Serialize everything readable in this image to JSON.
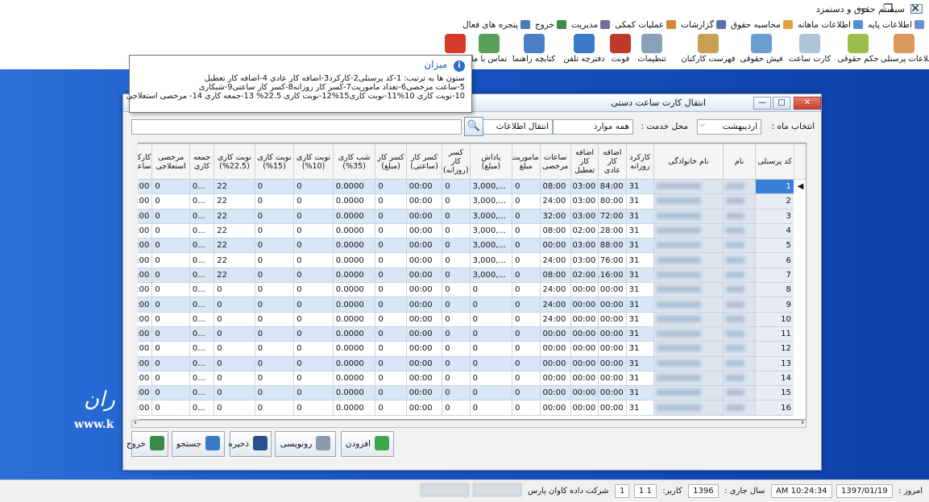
{
  "window": {
    "title": "سیستم حقوق و دستمزد",
    "minimize": "—",
    "restore": "❐",
    "close": "✕"
  },
  "menu": [
    {
      "label": "اطلاعات پایه",
      "color": "#6a8fd0"
    },
    {
      "label": "اطلاعات ماهانه",
      "color": "#4f8fd6"
    },
    {
      "label": "محاسبه حقوق",
      "color": "#e2a23a"
    },
    {
      "label": "گزارشات",
      "color": "#5a6fa8"
    },
    {
      "label": "عملیات کمکی",
      "color": "#d0883a"
    },
    {
      "label": "مدیریت",
      "color": "#7a6aa0"
    },
    {
      "label": "خروج",
      "color": "#3a8a4a"
    },
    {
      "label": "پنجره های فعال",
      "color": "#4a7ab0"
    }
  ],
  "toolbar": [
    {
      "label": "اطلاعات پرسنلی",
      "color": "#d89a5a"
    },
    {
      "label": "حکم حقوقی",
      "color": "#9bbf4a"
    },
    {
      "label": "کارت ساعت",
      "color": "#b0c4d8"
    },
    {
      "label": "فیش حقوقی",
      "color": "#6a9fd0"
    },
    {
      "label": "فهرست کارکنان",
      "color": "#c8a050"
    },
    {
      "label": "تنظیمات",
      "color": "#8aa0b8"
    },
    {
      "label": "فونت",
      "color": "#c0392b"
    },
    {
      "label": "دفترچه تلفن",
      "color": "#3a7ac8"
    },
    {
      "label": "کتابچه راهنما",
      "color": "#4a7fc4"
    },
    {
      "label": "تماس با ما",
      "color": "#5aa05a"
    },
    {
      "label": "",
      "color": "#d83a2a"
    }
  ],
  "tooltip": {
    "title": "میزان",
    "info_glyph": "i",
    "lines": [
      "ستون ها به ترتیب: 1-کد پرسنلی2-کارکرد3-اضافه کار عادی 4-اضافه کار تعطیل",
      "5-ساعت مرخصی6-تعداد ماموریت7-کسر کار روزانه8-کسر کار ساعتی9-شبکاری",
      "10-نوبت کاری 10%11-نوبت کاری15%12-نوبت کاری 22.5% 13-جمعه کاری 14- مرخصی استعلاجی"
    ]
  },
  "dialog": {
    "title": "انتقال کارت ساعت دستی",
    "month_label": "انتخاب ماه :",
    "month_value": "اردیبهشت",
    "service_label": "محل خدمت :",
    "service_value": "همه موارد",
    "info_transfer": "انتقال اطلاعات",
    "search_value": ""
  },
  "grid": {
    "headers": [
      "کد پرسنلی",
      "نام",
      "نام خانوادگی",
      "کارکرد روزانه",
      "اضافه کار عادی",
      "اضافه کار تعطیل",
      "ساعات مرخصی",
      "ماموریت مبلغ",
      "پاداش (مبلغ)",
      "کسر کار (روزانه)",
      "کسر کار (ساعتی)",
      "کسر کار (مبلغ)",
      "شب کاری (35%)",
      "نوبت کاری (10%)",
      "نوبت کاری (15%)",
      "نوبت کاری (22.5%)",
      "جمعه کاری",
      "مرخصی استعلاجی",
      "کارکرد ساعت"
    ],
    "rows": [
      [
        "1",
        "31",
        "84:00",
        "03:00",
        "08:00",
        "0",
        "...,3,000",
        "0",
        "00:00",
        "0",
        "0.0000",
        "0",
        "0",
        "22",
        "...0",
        "0",
        "00:00"
      ],
      [
        "2",
        "31",
        "80:00",
        "03:00",
        "24:00",
        "0",
        "...,3,000",
        "0",
        "00:00",
        "0",
        "0.0000",
        "0",
        "0",
        "22",
        "...0",
        "0",
        "00:00"
      ],
      [
        "3",
        "31",
        "72:00",
        "03:00",
        "32:00",
        "0",
        "...,3,000",
        "0",
        "00:00",
        "0",
        "0.0000",
        "0",
        "0",
        "22",
        "...0",
        "0",
        "00:00"
      ],
      [
        "4",
        "31",
        "128:00",
        "02:00",
        "08:00",
        "0",
        "...,3,000",
        "0",
        "00:00",
        "0",
        "0.0000",
        "0",
        "0",
        "22",
        "...0",
        "0",
        "00:00"
      ],
      [
        "5",
        "31",
        "88:00",
        "03:00",
        "00:00",
        "0",
        "...,3,000",
        "0",
        "00:00",
        "0",
        "0.0000",
        "0",
        "0",
        "22",
        "...0",
        "0",
        "00:00"
      ],
      [
        "6",
        "31",
        "76:00",
        "03:00",
        "24:00",
        "0",
        "...,3,000",
        "0",
        "00:00",
        "0",
        "0.0000",
        "0",
        "0",
        "22",
        "...0",
        "0",
        "00:00"
      ],
      [
        "7",
        "31",
        "116:00",
        "02:00",
        "08:00",
        "0",
        "...,3,000",
        "0",
        "00:00",
        "0",
        "0.0000",
        "0",
        "0",
        "22",
        "...0",
        "0",
        "00:00"
      ],
      [
        "8",
        "31",
        "00:00",
        "00:00",
        "24:00",
        "0",
        "0",
        "0",
        "00:00",
        "0",
        "0.0000",
        "0",
        "0",
        "0",
        "...0",
        "0",
        "00:00"
      ],
      [
        "9",
        "31",
        "00:00",
        "00:00",
        "24:00",
        "0",
        "0",
        "0",
        "00:00",
        "0",
        "0.0000",
        "0",
        "0",
        "0",
        "...0",
        "0",
        "00:00"
      ],
      [
        "10",
        "31",
        "00:00",
        "00:00",
        "24:00",
        "0",
        "0",
        "0",
        "00:00",
        "0",
        "0.0000",
        "0",
        "0",
        "0",
        "...0",
        "0",
        "00:00"
      ],
      [
        "11",
        "31",
        "00:00",
        "00:00",
        "00:00",
        "0",
        "0",
        "0",
        "00:00",
        "0",
        "0.0000",
        "0",
        "0",
        "0",
        "...0",
        "0",
        "00:00"
      ],
      [
        "12",
        "31",
        "00:00",
        "00:00",
        "00:00",
        "0",
        "0",
        "0",
        "00:00",
        "0",
        "0.0000",
        "0",
        "0",
        "0",
        "...0",
        "0",
        "00:00"
      ],
      [
        "13",
        "31",
        "00:00",
        "00:00",
        "00:00",
        "0",
        "0",
        "0",
        "00:00",
        "0",
        "0.0000",
        "0",
        "0",
        "0",
        "...0",
        "0",
        "00:00"
      ],
      [
        "14",
        "31",
        "00:00",
        "00:00",
        "00:00",
        "0",
        "0",
        "0",
        "00:00",
        "0",
        "0.0000",
        "0",
        "0",
        "0",
        "...0",
        "0",
        "00:00"
      ],
      [
        "15",
        "31",
        "00:00",
        "00:00",
        "00:00",
        "0",
        "0",
        "0",
        "00:00",
        "0",
        "0.0000",
        "0",
        "0",
        "0",
        "...0",
        "0",
        "00:00"
      ],
      [
        "16",
        "31",
        "00:00",
        "00:00",
        "00:00",
        "0",
        "0",
        "0",
        "00:00",
        "0",
        "0.0000",
        "0",
        "0",
        "0",
        "...0",
        "0",
        "00:00"
      ]
    ],
    "selected_row": "1",
    "row_indicator": "◀"
  },
  "buttons": [
    {
      "label": "افزودن",
      "color": "#3aa84a"
    },
    {
      "label": "رونویسی",
      "color": "#8a9ab0"
    },
    {
      "label": "ذخیره",
      "color": "#2a4f8a"
    },
    {
      "label": "جستجو",
      "color": "#3a7ac8"
    },
    {
      "label": "خروج",
      "color": "#3a8a4a"
    }
  ],
  "desktop": {
    "logo": "ران",
    "url": "www.k"
  },
  "statusbar": {
    "today_label": "امروز :",
    "date": "1397/01/19",
    "time": "AM 10:24:34",
    "year_label": "سال جاری :",
    "year": "1396",
    "user_label": "کاربر:",
    "user_id": "1 1",
    "count": "1",
    "company": "شرکت داده کاوان پارس"
  }
}
